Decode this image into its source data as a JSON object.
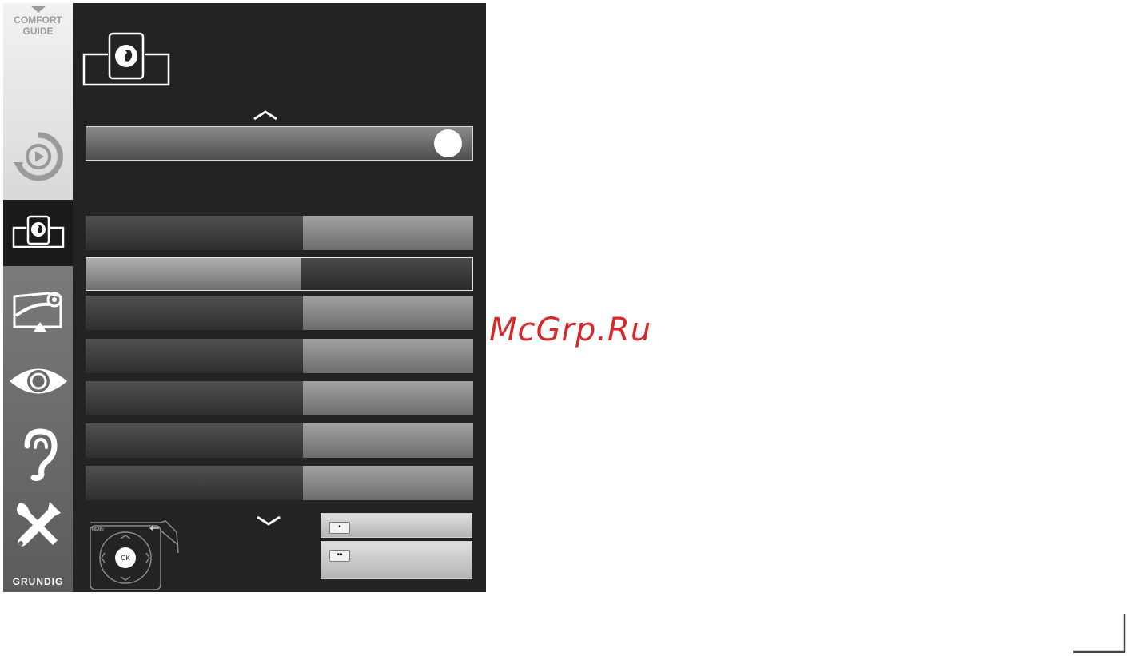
{
  "sidebar": {
    "comfort_guide": {
      "line1": "COMFORT",
      "line2": "GUIDE"
    },
    "items": [
      {
        "icon": "source-play-icon",
        "state": "inactive"
      },
      {
        "icon": "network-globe-icon",
        "state": "active"
      },
      {
        "icon": "picture-settings-icon",
        "state": "inactive"
      },
      {
        "icon": "eye-icon",
        "state": "inactive"
      },
      {
        "icon": "ear-icon",
        "state": "inactive"
      },
      {
        "icon": "tools-icon",
        "state": "inactive"
      }
    ],
    "brand": "GRUNDIG"
  },
  "panel": {
    "header_icon": "network-globe-icon",
    "slider": {
      "knob_position": 1.0
    },
    "rows": [
      {
        "label": "",
        "value": "",
        "selected": false
      },
      {
        "label": "",
        "value": "",
        "selected": true
      },
      {
        "label": "",
        "value": "",
        "selected": false
      },
      {
        "label": "",
        "value": "",
        "selected": false
      },
      {
        "label": "",
        "value": "",
        "selected": false
      },
      {
        "label": "",
        "value": "",
        "selected": false
      },
      {
        "label": "",
        "value": "",
        "selected": false
      }
    ],
    "remote": {
      "ok_label": "OK",
      "menu_label": "MENU"
    },
    "buttons": [
      {
        "key": "•",
        "label": ""
      },
      {
        "key": "••",
        "label": ""
      }
    ]
  },
  "watermark": "McGrp.Ru",
  "colors": {
    "panel_bg": "#232323",
    "watermark": "#d42a2a",
    "sidebar_active": "#1a1a1a"
  }
}
